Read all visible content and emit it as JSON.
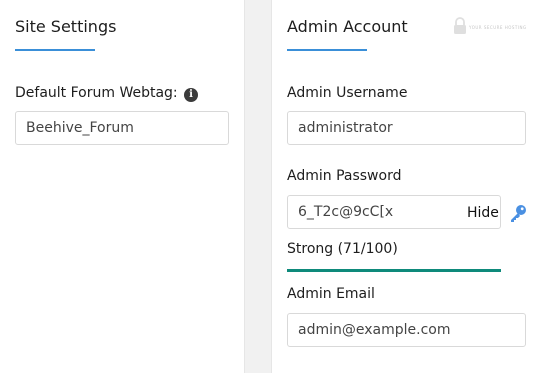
{
  "site_settings": {
    "heading": "Site Settings",
    "webtag_label": "Default Forum Webtag:",
    "webtag_value": "Beehive_Forum"
  },
  "admin_account": {
    "heading": "Admin Account",
    "username_label": "Admin Username",
    "username_value": "administrator",
    "password_label": "Admin Password",
    "password_value": "6_T2c@9cC[x",
    "hide_label": "Hide",
    "strength_text": "Strong (71/100)",
    "strength_score": 71,
    "strength_max": 100,
    "email_label": "Admin Email",
    "email_value": "admin@example.com"
  },
  "watermark": {
    "text": "YOUR SECURE HOSTING"
  },
  "colors": {
    "accent": "#3a8fd8",
    "strength": "#0e8a7b",
    "key_icon": "#4a90e2"
  },
  "icons": {
    "info": "info-icon",
    "key": "key-icon",
    "lock": "lock-icon"
  }
}
